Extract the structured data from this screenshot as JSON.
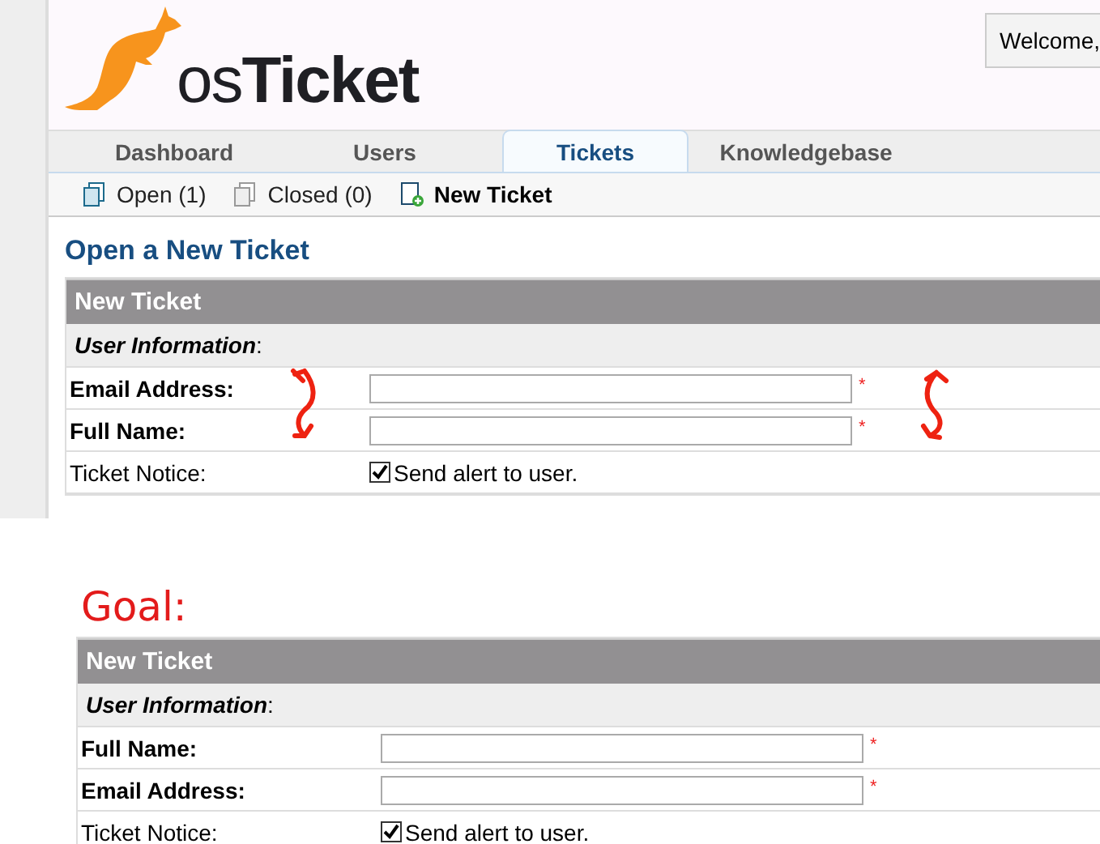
{
  "header": {
    "logo": {
      "prefix": "os",
      "name": "Ticket"
    },
    "welcome": "Welcome,"
  },
  "tabs": [
    {
      "label": "Dashboard",
      "selected": false
    },
    {
      "label": "Users",
      "selected": false
    },
    {
      "label": "Tickets",
      "selected": true
    },
    {
      "label": "Knowledgebase",
      "selected": false
    }
  ],
  "subnav": [
    {
      "kind": "open",
      "label": "Open (1)",
      "selected": false
    },
    {
      "kind": "closed",
      "label": "Closed (0)",
      "selected": false
    },
    {
      "kind": "new",
      "label": "New Ticket",
      "selected": true
    }
  ],
  "page_title": "Open a New Ticket",
  "form": {
    "header": "New Ticket",
    "section": "*User Information*:",
    "fields": [
      {
        "kind": "text",
        "label": "Email Address:",
        "required": true,
        "marker": "*"
      },
      {
        "kind": "text",
        "label": "Full Name:",
        "required": true,
        "marker": "*"
      },
      {
        "kind": "checkbox",
        "label": "Ticket Notice:",
        "option": "Send alert to user.",
        "checked": true
      }
    ]
  },
  "goal": {
    "label": "Goal:",
    "form": {
      "header": "New Ticket",
      "section": "*User Information*:",
      "fields": [
        {
          "kind": "text",
          "label": "Full Name:",
          "required": true,
          "marker": "*"
        },
        {
          "kind": "text",
          "label": "Email Address:",
          "required": true,
          "marker": "*"
        },
        {
          "kind": "checkbox",
          "label": "Ticket Notice:",
          "option": "Send alert to user.",
          "checked": true
        }
      ]
    }
  }
}
